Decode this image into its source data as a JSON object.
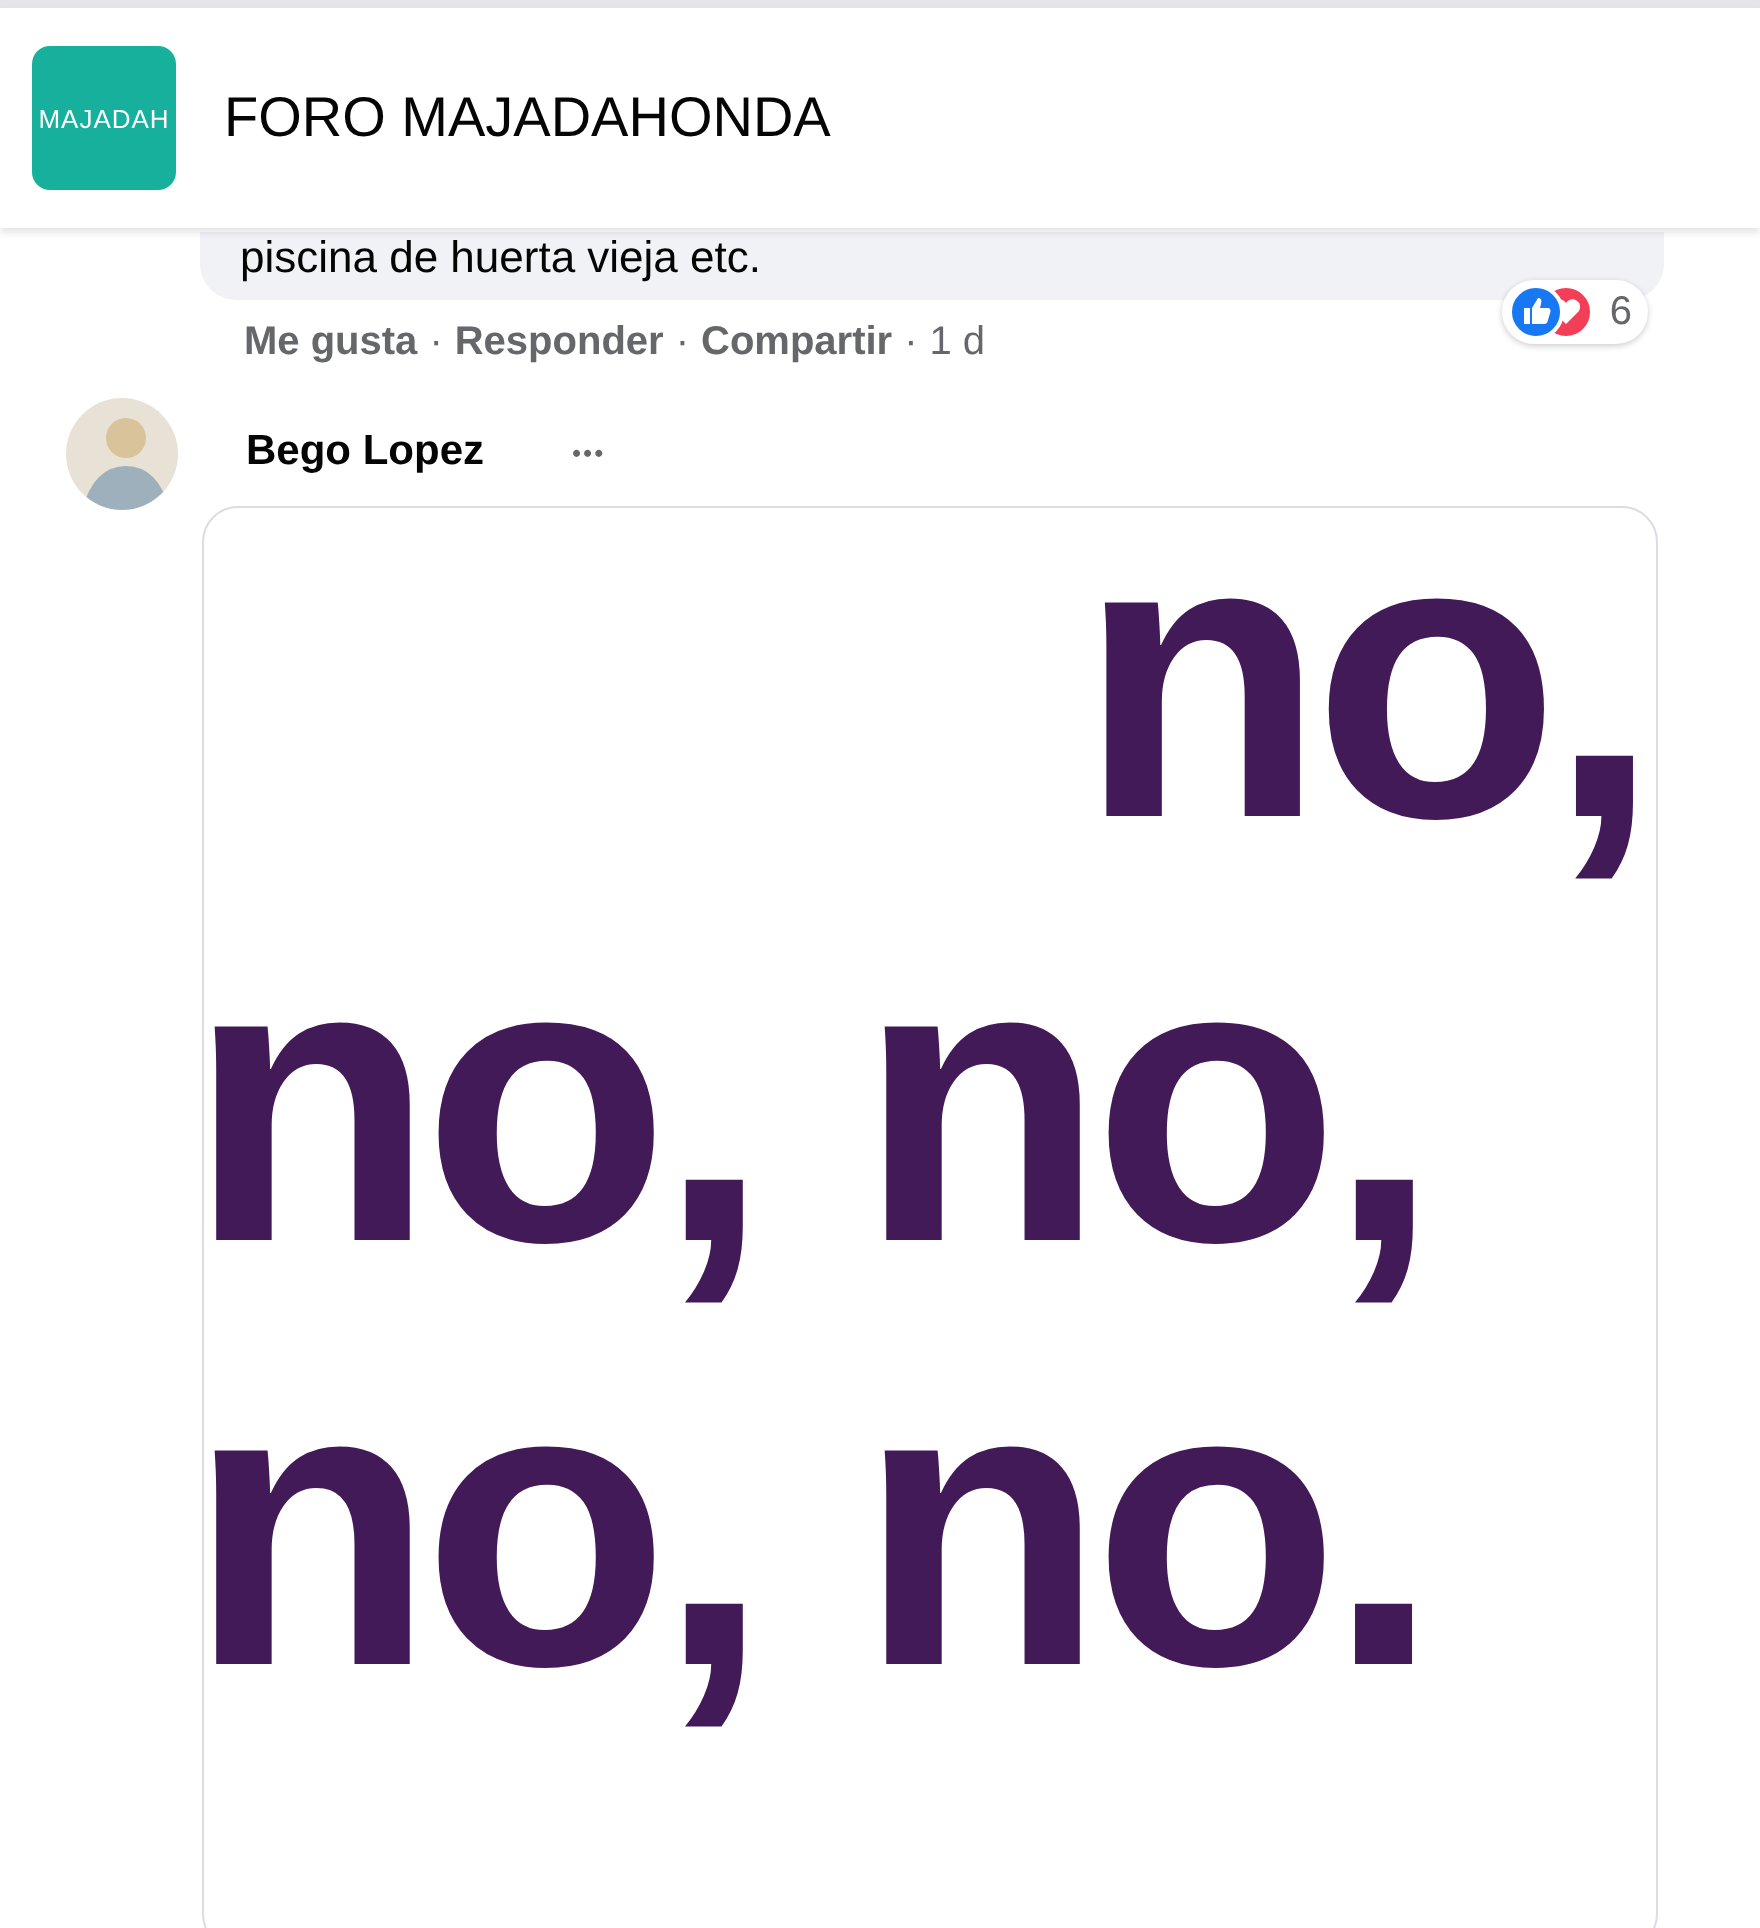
{
  "header": {
    "logo_text": "MAJADAH",
    "title": "FORO MAJADAHONDA"
  },
  "previous_comment": {
    "text": "piscina de huerta vieja etc.",
    "reaction_count": "6",
    "actions": [
      "Me gusta",
      "Responder",
      "Compartir"
    ],
    "separator": "·",
    "time": "1 d"
  },
  "comment": {
    "author": "Bego Lopez",
    "more": "•••",
    "attachment_lines": [
      "no,",
      "no, no,",
      "no, no."
    ]
  }
}
